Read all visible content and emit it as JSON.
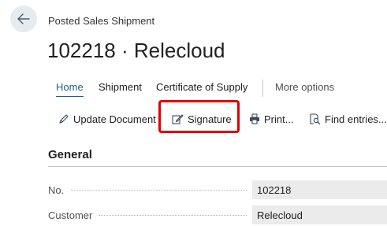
{
  "header": {
    "caption": "Posted Sales Shipment",
    "title": "102218 · Relecloud"
  },
  "tabs": {
    "home": "Home",
    "shipment": "Shipment",
    "certificate": "Certificate of Supply",
    "more": "More options"
  },
  "actions": {
    "update_document": "Update Document",
    "signature": "Signature",
    "print": "Print...",
    "find_entries": "Find entries..."
  },
  "section": {
    "title": "General"
  },
  "fields": {
    "no_label": "No.",
    "no_value": "102218",
    "customer_label": "Customer",
    "customer_value": "Relecloud"
  },
  "colors": {
    "accent": "#1f5f8a",
    "highlight": "#e00000",
    "field_background": "#ebebeb"
  }
}
